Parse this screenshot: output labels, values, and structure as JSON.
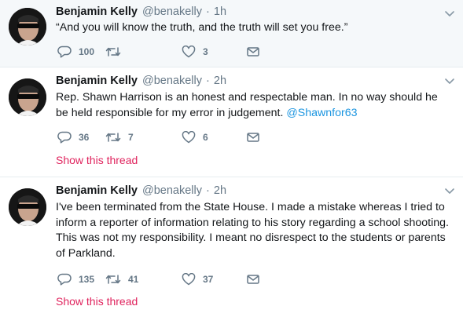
{
  "colors": {
    "accent": "#1b95e0",
    "thread": "#e0245e",
    "muted": "#657786",
    "highlight_bg": "#f5f8fa"
  },
  "tweets": [
    {
      "name": "Benjamin Kelly",
      "handle": "@benakelly",
      "separator": "·",
      "time": "1h",
      "text": "“And you will know the truth, and the truth will set you free.”",
      "mention": "",
      "replies": "100",
      "retweets": "",
      "likes": "3",
      "show_thread": ""
    },
    {
      "name": "Benjamin Kelly",
      "handle": "@benakelly",
      "separator": "·",
      "time": "2h",
      "text": "Rep. Shawn Harrison is an honest and respectable man. In no way should he be held responsible for my error in judgement. ",
      "mention": "@Shawnfor63",
      "replies": "36",
      "retweets": "7",
      "likes": "6",
      "show_thread": "Show this thread"
    },
    {
      "name": "Benjamin Kelly",
      "handle": "@benakelly",
      "separator": "·",
      "time": "2h",
      "text": "I've been terminated from the State House. I made a mistake whereas I tried to inform a reporter of information relating to his story regarding a school shooting. This was not my responsibility.  I meant no disrespect to the students or parents of Parkland.",
      "mention": "",
      "replies": "135",
      "retweets": "41",
      "likes": "37",
      "show_thread": "Show this thread"
    }
  ],
  "icons": [
    "avatar",
    "caret-down-icon",
    "reply-icon",
    "retweet-icon",
    "like-icon",
    "message-icon"
  ]
}
